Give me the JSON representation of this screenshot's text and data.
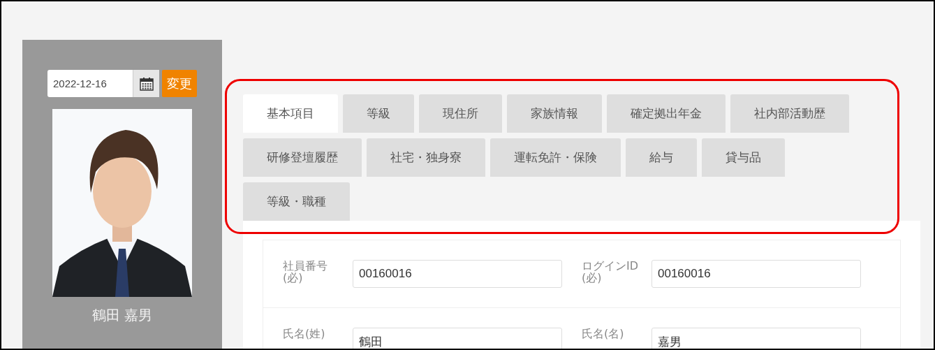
{
  "date_picker": {
    "value": "2022-12-16"
  },
  "change_button": "変更",
  "employee": {
    "name": "鶴田 嘉男"
  },
  "tabs": [
    {
      "label": "基本項目",
      "selected": true
    },
    {
      "label": "等級",
      "selected": false
    },
    {
      "label": "現住所",
      "selected": false
    },
    {
      "label": "家族情報",
      "selected": false
    },
    {
      "label": "確定拠出年金",
      "selected": false
    },
    {
      "label": "社内部活動歴",
      "selected": false
    },
    {
      "label": "研修登壇履歴",
      "selected": false
    },
    {
      "label": "社宅・独身寮",
      "selected": false
    },
    {
      "label": "運転免許・保険",
      "selected": false
    },
    {
      "label": "給与",
      "selected": false
    },
    {
      "label": "貸与品",
      "selected": false
    },
    {
      "label": "等級・職種",
      "selected": false
    }
  ],
  "form": {
    "rows": [
      {
        "fields": [
          {
            "label": "社員番号",
            "note": "(必)",
            "value": "00160016"
          },
          {
            "label": "ログインID",
            "note": "(必)",
            "value": "00160016"
          }
        ]
      },
      {
        "fields": [
          {
            "label": "氏名(姓)",
            "value": "鶴田"
          },
          {
            "label": "氏名(名)",
            "value": "嘉男"
          }
        ]
      }
    ]
  }
}
